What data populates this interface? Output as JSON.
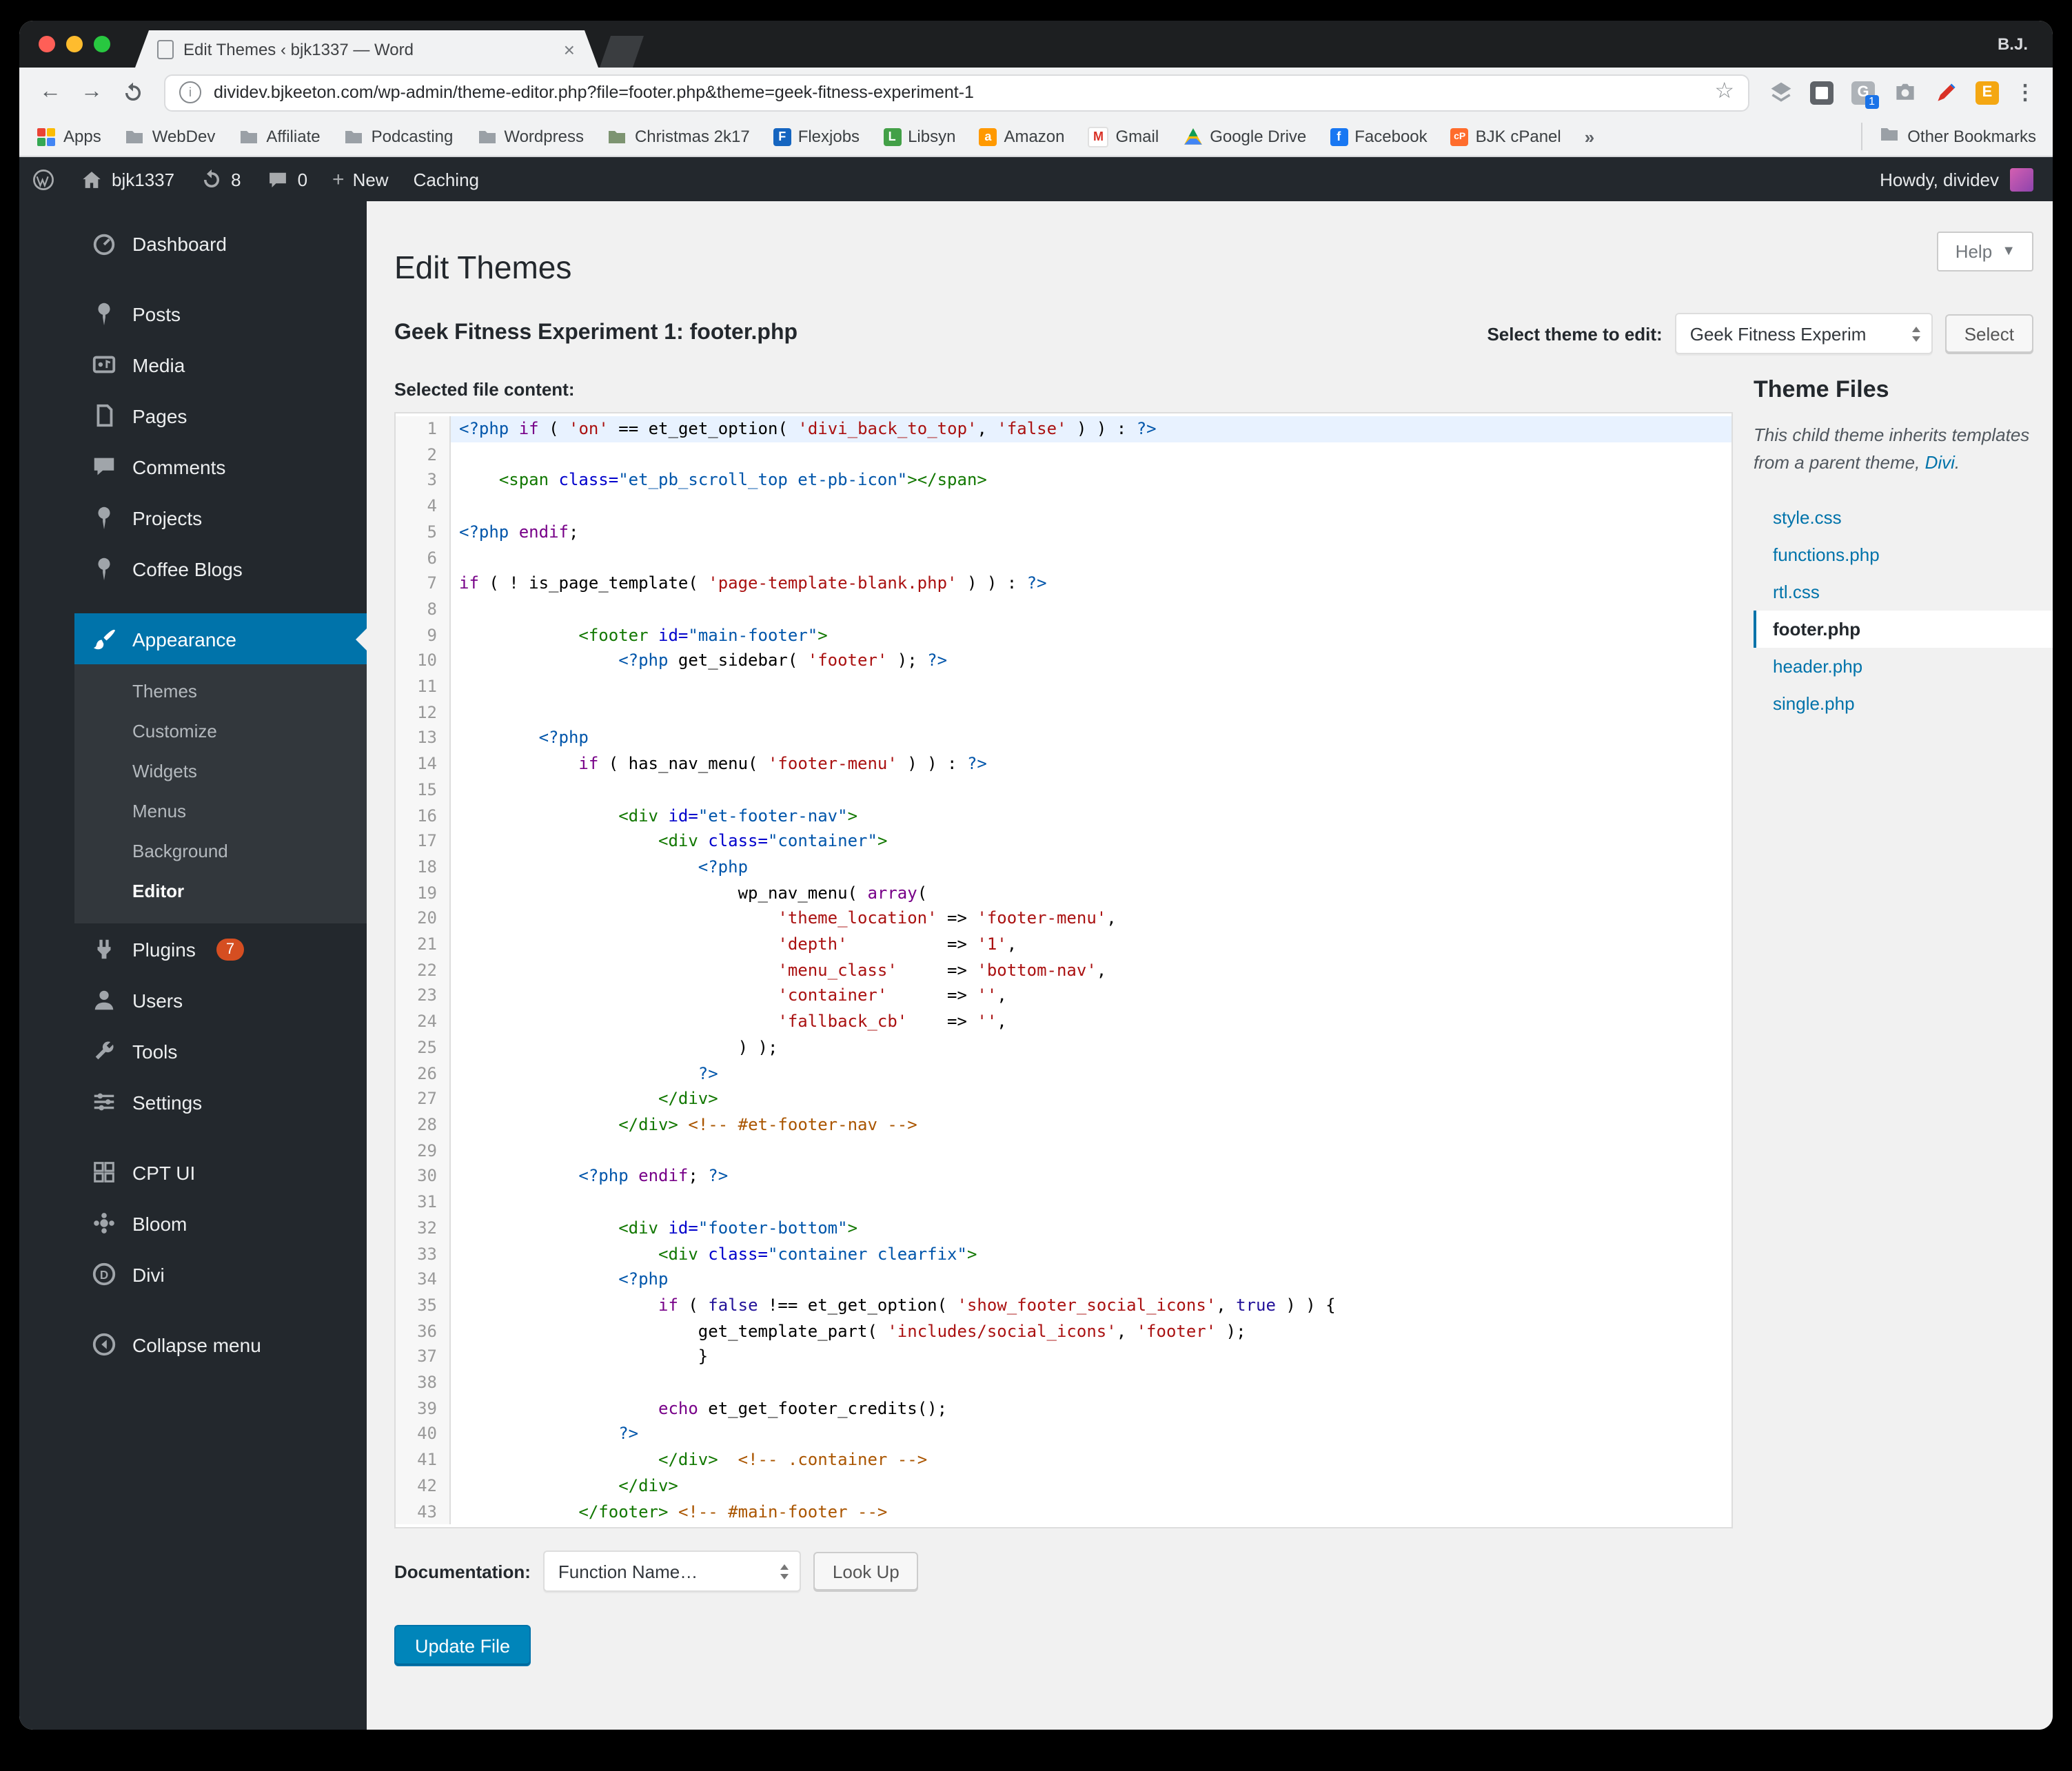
{
  "colors": {
    "wp_accent": "#0073aa",
    "button_primary": "#0085ba",
    "plugins_badge_bg": "#d54e21",
    "active_line_bg": "#e8f2ff",
    "adminbar_bg": "#23282d"
  },
  "browser": {
    "profile": "B.J.",
    "tab_title": "Edit Themes ‹ bjk1337 — Word",
    "url": "dividev.bjkeeton.com/wp-admin/theme-editor.php?file=footer.php&theme=geek-fitness-experiment-1",
    "bookmarks": [
      "Apps",
      "WebDev",
      "Affiliate",
      "Podcasting",
      "Wordpress",
      "Christmas 2k17",
      "Flexjobs",
      "Libsyn",
      "Amazon",
      "Gmail",
      "Google Drive",
      "Facebook",
      "BJK cPanel"
    ],
    "bookmarks_overflow": "»",
    "other_bookmarks": "Other Bookmarks"
  },
  "adminbar": {
    "site": "bjk1337",
    "updates": "8",
    "comments": "0",
    "new_label": "New",
    "caching": "Caching",
    "howdy": "Howdy, dividev"
  },
  "sidebar": {
    "items": [
      {
        "label": "Dashboard"
      },
      {
        "label": "Posts"
      },
      {
        "label": "Media"
      },
      {
        "label": "Pages"
      },
      {
        "label": "Comments"
      },
      {
        "label": "Projects"
      },
      {
        "label": "Coffee Blogs"
      },
      {
        "label": "Appearance"
      },
      {
        "label": "Plugins"
      },
      {
        "label": "Users"
      },
      {
        "label": "Tools"
      },
      {
        "label": "Settings"
      },
      {
        "label": "CPT UI"
      },
      {
        "label": "Bloom"
      },
      {
        "label": "Divi"
      },
      {
        "label": "Collapse menu"
      }
    ],
    "plugins_badge": "7",
    "submenu": [
      "Themes",
      "Customize",
      "Widgets",
      "Menus",
      "Background",
      "Editor"
    ],
    "submenu_current": "Editor"
  },
  "page": {
    "title": "Edit Themes",
    "help": "Help",
    "heading": "Geek Fitness Experiment 1: footer.php",
    "select_theme_label": "Select theme to edit:",
    "select_theme_value": "Geek Fitness Experim",
    "select_button": "Select",
    "file_label": "Selected file content:",
    "docs_label": "Documentation:",
    "docs_value": "Function Name…",
    "lookup": "Look Up",
    "update": "Update File"
  },
  "theme_files": {
    "title": "Theme Files",
    "desc_prefix": "This child theme inherits templates from a parent theme, ",
    "desc_link": "Divi",
    "desc_suffix": ".",
    "files": [
      "style.css",
      "functions.php",
      "rtl.css",
      "footer.php",
      "header.php",
      "single.php"
    ],
    "current": "footer.php"
  },
  "editor": {
    "lines": [
      {
        "n": 1,
        "active": true,
        "t": [
          [
            "m",
            "<?php "
          ],
          [
            "k",
            "if"
          ],
          [
            "p",
            " ( "
          ],
          [
            "s",
            "'on'"
          ],
          [
            "p",
            " == et_get_option( "
          ],
          [
            "s",
            "'divi_back_to_top'"
          ],
          [
            "p",
            ", "
          ],
          [
            "s",
            "'false'"
          ],
          [
            "p",
            " ) ) : "
          ],
          [
            "m",
            "?>"
          ]
        ]
      },
      {
        "n": 2,
        "t": []
      },
      {
        "n": 3,
        "t": [
          [
            "p",
            "    "
          ],
          [
            "t",
            "<span"
          ],
          [
            "at",
            " class="
          ],
          [
            "av",
            "\"et_pb_scroll_top et-pb-icon\""
          ],
          [
            "t",
            "></span>"
          ]
        ]
      },
      {
        "n": 4,
        "t": []
      },
      {
        "n": 5,
        "t": [
          [
            "m",
            "<?php "
          ],
          [
            "k",
            "endif"
          ],
          [
            "p",
            ";"
          ]
        ]
      },
      {
        "n": 6,
        "t": []
      },
      {
        "n": 7,
        "t": [
          [
            "k",
            "if"
          ],
          [
            "p",
            " ( ! is_page_template( "
          ],
          [
            "s",
            "'page-template-blank.php'"
          ],
          [
            "p",
            " ) ) : "
          ],
          [
            "m",
            "?>"
          ]
        ]
      },
      {
        "n": 8,
        "t": []
      },
      {
        "n": 9,
        "t": [
          [
            "p",
            "            "
          ],
          [
            "t",
            "<footer"
          ],
          [
            "at",
            " id="
          ],
          [
            "av",
            "\"main-footer\""
          ],
          [
            "t",
            ">"
          ]
        ]
      },
      {
        "n": 10,
        "t": [
          [
            "p",
            "                "
          ],
          [
            "m",
            "<?php "
          ],
          [
            "p",
            "get_sidebar( "
          ],
          [
            "s",
            "'footer'"
          ],
          [
            "p",
            " ); "
          ],
          [
            "m",
            "?>"
          ]
        ]
      },
      {
        "n": 11,
        "t": []
      },
      {
        "n": 12,
        "t": []
      },
      {
        "n": 13,
        "t": [
          [
            "p",
            "        "
          ],
          [
            "m",
            "<?php"
          ]
        ]
      },
      {
        "n": 14,
        "t": [
          [
            "p",
            "            "
          ],
          [
            "k",
            "if"
          ],
          [
            "p",
            " ( has_nav_menu( "
          ],
          [
            "s",
            "'footer-menu'"
          ],
          [
            "p",
            " ) ) : "
          ],
          [
            "m",
            "?>"
          ]
        ]
      },
      {
        "n": 15,
        "t": []
      },
      {
        "n": 16,
        "t": [
          [
            "p",
            "                "
          ],
          [
            "t",
            "<div"
          ],
          [
            "at",
            " id="
          ],
          [
            "av",
            "\"et-footer-nav\""
          ],
          [
            "t",
            ">"
          ]
        ]
      },
      {
        "n": 17,
        "t": [
          [
            "p",
            "                    "
          ],
          [
            "t",
            "<div"
          ],
          [
            "at",
            " class="
          ],
          [
            "av",
            "\"container\""
          ],
          [
            "t",
            ">"
          ]
        ]
      },
      {
        "n": 18,
        "t": [
          [
            "p",
            "                        "
          ],
          [
            "m",
            "<?php"
          ]
        ]
      },
      {
        "n": 19,
        "t": [
          [
            "p",
            "                            "
          ],
          [
            "p",
            "wp_nav_menu( "
          ],
          [
            "k",
            "array"
          ],
          [
            "p",
            "("
          ]
        ]
      },
      {
        "n": 20,
        "t": [
          [
            "p",
            "                                "
          ],
          [
            "s",
            "'theme_location'"
          ],
          [
            "p",
            " => "
          ],
          [
            "s",
            "'footer-menu'"
          ],
          [
            "p",
            ","
          ]
        ]
      },
      {
        "n": 21,
        "t": [
          [
            "p",
            "                                "
          ],
          [
            "s",
            "'depth'"
          ],
          [
            "p",
            "          => "
          ],
          [
            "s",
            "'1'"
          ],
          [
            "p",
            ","
          ]
        ]
      },
      {
        "n": 22,
        "t": [
          [
            "p",
            "                                "
          ],
          [
            "s",
            "'menu_class'"
          ],
          [
            "p",
            "     => "
          ],
          [
            "s",
            "'bottom-nav'"
          ],
          [
            "p",
            ","
          ]
        ]
      },
      {
        "n": 23,
        "t": [
          [
            "p",
            "                                "
          ],
          [
            "s",
            "'container'"
          ],
          [
            "p",
            "      => "
          ],
          [
            "s",
            "''"
          ],
          [
            "p",
            ","
          ]
        ]
      },
      {
        "n": 24,
        "t": [
          [
            "p",
            "                                "
          ],
          [
            "s",
            "'fallback_cb'"
          ],
          [
            "p",
            "    => "
          ],
          [
            "s",
            "''"
          ],
          [
            "p",
            ","
          ]
        ]
      },
      {
        "n": 25,
        "t": [
          [
            "p",
            "                            "
          ],
          [
            "p",
            ") );"
          ]
        ]
      },
      {
        "n": 26,
        "t": [
          [
            "p",
            "                        "
          ],
          [
            "m",
            "?>"
          ]
        ]
      },
      {
        "n": 27,
        "t": [
          [
            "p",
            "                    "
          ],
          [
            "t",
            "</div>"
          ]
        ]
      },
      {
        "n": 28,
        "t": [
          [
            "p",
            "                "
          ],
          [
            "t",
            "</div>"
          ],
          [
            "p",
            " "
          ],
          [
            "c",
            "<!-- #et-footer-nav -->"
          ]
        ]
      },
      {
        "n": 29,
        "t": []
      },
      {
        "n": 30,
        "t": [
          [
            "p",
            "            "
          ],
          [
            "m",
            "<?php "
          ],
          [
            "k",
            "endif"
          ],
          [
            "p",
            "; "
          ],
          [
            "m",
            "?>"
          ]
        ]
      },
      {
        "n": 31,
        "t": []
      },
      {
        "n": 32,
        "t": [
          [
            "p",
            "                "
          ],
          [
            "t",
            "<div"
          ],
          [
            "at",
            " id="
          ],
          [
            "av",
            "\"footer-bottom\""
          ],
          [
            "t",
            ">"
          ]
        ]
      },
      {
        "n": 33,
        "t": [
          [
            "p",
            "                    "
          ],
          [
            "t",
            "<div"
          ],
          [
            "at",
            " class="
          ],
          [
            "av",
            "\"container clearfix\""
          ],
          [
            "t",
            ">"
          ]
        ]
      },
      {
        "n": 34,
        "t": [
          [
            "p",
            "                "
          ],
          [
            "m",
            "<?php"
          ]
        ]
      },
      {
        "n": 35,
        "t": [
          [
            "p",
            "                    "
          ],
          [
            "k",
            "if"
          ],
          [
            "p",
            " ( "
          ],
          [
            "a",
            "false"
          ],
          [
            "p",
            " !== et_get_option( "
          ],
          [
            "s",
            "'show_footer_social_icons'"
          ],
          [
            "p",
            ", "
          ],
          [
            "a",
            "true"
          ],
          [
            "p",
            " ) ) {"
          ]
        ]
      },
      {
        "n": 36,
        "t": [
          [
            "p",
            "                        "
          ],
          [
            "p",
            "get_template_part( "
          ],
          [
            "s",
            "'includes/social_icons'"
          ],
          [
            "p",
            ", "
          ],
          [
            "s",
            "'footer'"
          ],
          [
            "p",
            " );"
          ]
        ]
      },
      {
        "n": 37,
        "t": [
          [
            "p",
            "                        "
          ],
          [
            "p",
            "}"
          ]
        ]
      },
      {
        "n": 38,
        "t": []
      },
      {
        "n": 39,
        "t": [
          [
            "p",
            "                    "
          ],
          [
            "k",
            "echo"
          ],
          [
            "p",
            " et_get_footer_credits();"
          ]
        ]
      },
      {
        "n": 40,
        "t": [
          [
            "p",
            "                "
          ],
          [
            "m",
            "?>"
          ]
        ]
      },
      {
        "n": 41,
        "t": [
          [
            "p",
            "                    "
          ],
          [
            "t",
            "</div>"
          ],
          [
            "p",
            "  "
          ],
          [
            "c",
            "<!-- .container -->"
          ]
        ]
      },
      {
        "n": 42,
        "t": [
          [
            "p",
            "                "
          ],
          [
            "t",
            "</div>"
          ]
        ]
      },
      {
        "n": 43,
        "t": [
          [
            "p",
            "            "
          ],
          [
            "t",
            "</footer>"
          ],
          [
            "p",
            " "
          ],
          [
            "c",
            "<!-- #main-footer -->"
          ]
        ]
      }
    ]
  }
}
